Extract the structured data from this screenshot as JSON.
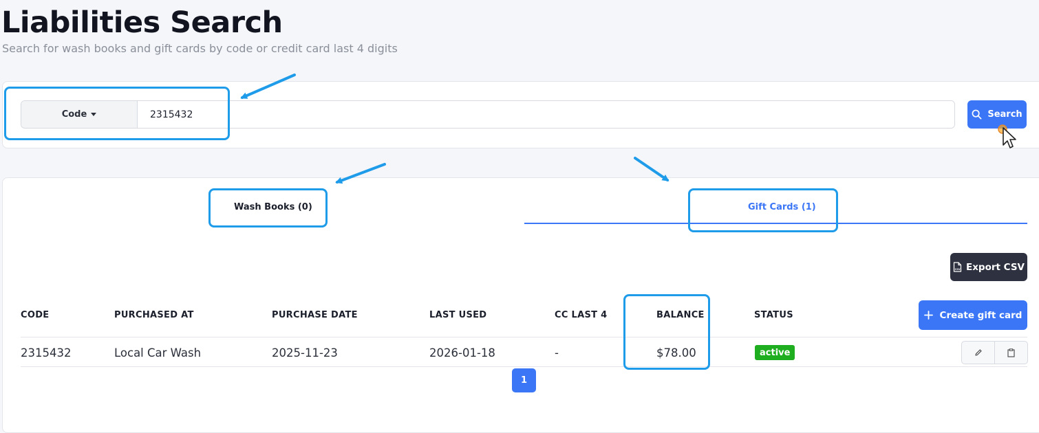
{
  "page": {
    "title": "Liabilities Search",
    "subtitle": "Search for wash books and gift cards by code or credit card last 4 digits"
  },
  "search": {
    "mode_label": "Code",
    "value": "2315432",
    "button_label": "Search",
    "button_icon": "search-icon"
  },
  "tabs": [
    {
      "label": "Wash Books (0)",
      "active": false
    },
    {
      "label": "Gift Cards (1)",
      "active": true
    }
  ],
  "toolbar": {
    "export_label": "Export CSV",
    "export_icon": "csv-file-icon",
    "create_label": "Create gift card",
    "create_icon": "plus-icon"
  },
  "table": {
    "columns": [
      "CODE",
      "PURCHASED AT",
      "PURCHASE DATE",
      "LAST USED",
      "CC LAST 4",
      "BALANCE",
      "STATUS"
    ],
    "rows": [
      {
        "code": "2315432",
        "purchased_at": "Local Car Wash",
        "purchase_date": "2025-11-23",
        "last_used": "2026-01-18",
        "cc_last4": "-",
        "balance": "$78.00",
        "status": "active",
        "actions": [
          "edit-icon",
          "clipboard-icon"
        ]
      }
    ]
  },
  "pagination": {
    "current_page": "1"
  },
  "colors": {
    "accent": "#3b76f6",
    "annotation": "#1e9be9",
    "status_active": "#1fae1f",
    "dark_button": "#2d3140"
  }
}
